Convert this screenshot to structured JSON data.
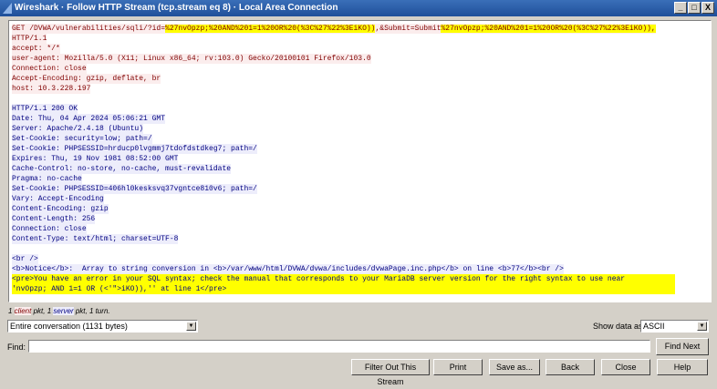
{
  "window": {
    "title": "Wireshark · Follow HTTP Stream (tcp.stream eq 8) · Local Area Connection",
    "controls": [
      "_",
      "□",
      "X"
    ]
  },
  "stream": {
    "client_lines": [
      [
        "GET /DVWA/vulnerabilities/sqli/?id=",
        "%27nvOpzp;%20AND%201=1%20OR%20(%3C%27%22%3EiKO))",
        ",&Submit=Submit",
        "%27nvOpzp;%20AND%201=1%20OR%20(%3C%27%22%3EiKO)),"
      ],
      "HTTP/1.1",
      "accept: */*",
      "user-agent: Mozilla/5.0 (X11; Linux x86_64; rv:103.0) Gecko/20100101 Firefox/103.0",
      "Connection: close",
      "Accept-Encoding: gzip, deflate, br",
      "host: 10.3.228.197"
    ],
    "server_lines": [
      "HTTP/1.1 200 OK",
      "Date: Thu, 04 Apr 2024 05:06:21 GMT",
      "Server: Apache/2.4.18 (Ubuntu)",
      "Set-Cookie: security=low; path=/",
      "Set-Cookie: PHPSESSID=hrducp0lvgmmj7tdofdstdkeg7; path=/",
      "Expires: Thu, 19 Nov 1981 08:52:00 GMT",
      "Cache-Control: no-store, no-cache, must-revalidate",
      "Pragma: no-cache",
      "Set-Cookie: PHPSESSID=406hl0kesksvq37vgntce810v6; path=/",
      "Vary: Accept-Encoding",
      "Content-Encoding: gzip",
      "Content-Length: 256",
      "Connection: close",
      "Content-Type: text/html; charset=UTF-8"
    ],
    "body_lines": [
      "<br />",
      "<b>Notice</b>:  Array to string conversion in <b>/var/www/html/DVWA/dvwa/includes/dvwaPage.inc.php</b> on line <b>77</b><br />"
    ],
    "highlighted_body_lines": [
      "<pre>You have an error in your SQL syntax; check the manual that corresponds to your MariaDB server version for the right syntax to use near",
      "'nvOpzp; AND 1=1 OR (<'\">iKO)),'' at line 1</pre>"
    ],
    "colors": {
      "client_text": "#800000",
      "client_bg": "#fbeded",
      "server_text": "#000080",
      "server_bg": "#ededfb",
      "highlight": "#ffff00"
    }
  },
  "status": {
    "p1": "1 ",
    "client": "client",
    "p2": " pkt, 1 ",
    "server": "server",
    "p3": " pkt, 1 turn."
  },
  "conversation_select": {
    "value": "Entire conversation (1131 bytes)"
  },
  "show_data_as": {
    "label": "Show data as",
    "value": "ASCII"
  },
  "find": {
    "label": "Find:",
    "value": "",
    "button": "Find Next"
  },
  "buttons": {
    "filter_out": "Filter Out This Stream",
    "print": "Print",
    "save_as": "Save as...",
    "back": "Back",
    "close": "Close",
    "help": "Help"
  }
}
